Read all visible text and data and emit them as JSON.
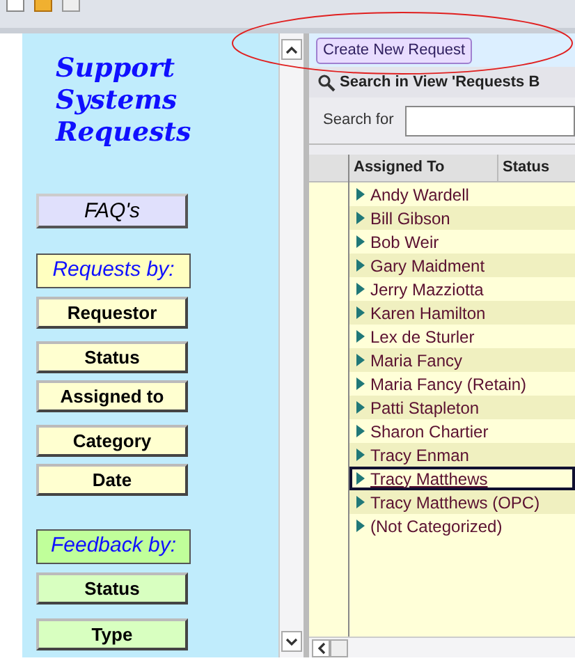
{
  "sidebar": {
    "title": "Support Systems Requests",
    "faq_button": "FAQ's",
    "groups": [
      {
        "label": "Requests by:",
        "kind": "requests",
        "buttons": [
          "Requestor",
          "Status",
          "Assigned to",
          "Category",
          "Date"
        ]
      },
      {
        "label": "Feedback by:",
        "kind": "feedback",
        "buttons": [
          "Status",
          "Type"
        ]
      }
    ]
  },
  "create_button": "Create New Request",
  "search_bar": {
    "title": "Search in View 'Requests B",
    "label": "Search for"
  },
  "table": {
    "columns": [
      "Assigned To",
      "Status"
    ],
    "rows": [
      {
        "name": "Andy Wardell",
        "selected": false
      },
      {
        "name": "Bill Gibson",
        "selected": false
      },
      {
        "name": "Bob Weir",
        "selected": false
      },
      {
        "name": "Gary Maidment",
        "selected": false
      },
      {
        "name": "Jerry Mazziotta",
        "selected": false
      },
      {
        "name": "Karen Hamilton",
        "selected": false
      },
      {
        "name": "Lex de Sturler",
        "selected": false
      },
      {
        "name": "Maria Fancy",
        "selected": false
      },
      {
        "name": "Maria Fancy (Retain)",
        "selected": false
      },
      {
        "name": "Patti Stapleton",
        "selected": false
      },
      {
        "name": "Sharon Chartier",
        "selected": false
      },
      {
        "name": "Tracy Enman",
        "selected": false
      },
      {
        "name": "Tracy Matthews",
        "selected": true
      },
      {
        "name": "Tracy Matthews (OPC)",
        "selected": false
      },
      {
        "name": "(Not Categorized)",
        "selected": false
      }
    ]
  }
}
